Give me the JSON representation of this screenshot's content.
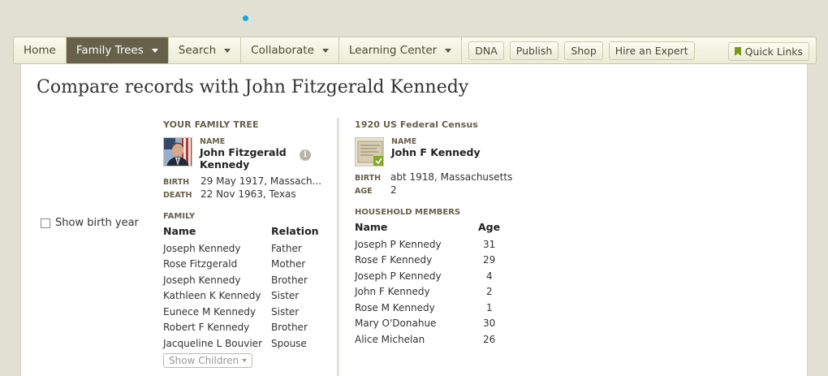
{
  "nav": {
    "items": [
      {
        "label": "Home",
        "dropdown": false
      },
      {
        "label": "Family Trees",
        "dropdown": true
      },
      {
        "label": "Search",
        "dropdown": true
      },
      {
        "label": "Collaborate",
        "dropdown": true
      },
      {
        "label": "Learning Center",
        "dropdown": true
      }
    ],
    "buttons": [
      "DNA",
      "Publish",
      "Shop",
      "Hire an Expert"
    ],
    "quick_links": "Quick Links",
    "active": "Family Trees"
  },
  "page": {
    "title": "Compare records with John Fitzgerald Kennedy",
    "show_birth_year": "Show birth year"
  },
  "tree": {
    "heading": "YOUR FAMILY TREE",
    "name_label": "NAME",
    "name": "John Fitzgerald Kennedy",
    "birth_label": "BIRTH",
    "birth": "29 May 1917, Massach...",
    "death_label": "DEATH",
    "death": "22 Nov 1963, Texas",
    "family_heading": "FAMILY",
    "columns": [
      "Name",
      "Relation"
    ],
    "family": [
      {
        "name": "Joseph Kennedy",
        "relation": "Father"
      },
      {
        "name": "Rose Fitzgerald",
        "relation": "Mother"
      },
      {
        "name": "Joseph Kennedy",
        "relation": "Brother"
      },
      {
        "name": "Kathleen K Kennedy",
        "relation": "Sister"
      },
      {
        "name": "Eunece M Kennedy",
        "relation": "Sister"
      },
      {
        "name": "Robert F Kennedy",
        "relation": "Brother"
      },
      {
        "name": "Jacqueline L Bouvier",
        "relation": "Spouse"
      }
    ],
    "show_children": "Show Children"
  },
  "census": {
    "heading": "1920 US Federal Census",
    "name_label": "NAME",
    "name": "John F Kennedy",
    "birth_label": "BIRTH",
    "birth": "abt 1918, Massachusetts",
    "age_label": "AGE",
    "age": "2",
    "household_heading": "HOUSEHOLD MEMBERS",
    "columns": [
      "Name",
      "Age"
    ],
    "members": [
      {
        "name": "Joseph P Kennedy",
        "age": "31"
      },
      {
        "name": "Rose F Kennedy",
        "age": "29"
      },
      {
        "name": "Joseph P Kennedy",
        "age": "4"
      },
      {
        "name": "John F Kennedy",
        "age": "2"
      },
      {
        "name": "Rose M Kennedy",
        "age": "1"
      },
      {
        "name": "Mary O'Donahue",
        "age": "30"
      },
      {
        "name": "Alice Michelan",
        "age": "26"
      }
    ]
  },
  "colors": {
    "accent": "#67604a",
    "nav_bg": "#f5f4e3",
    "dot": "#14a7dc"
  }
}
